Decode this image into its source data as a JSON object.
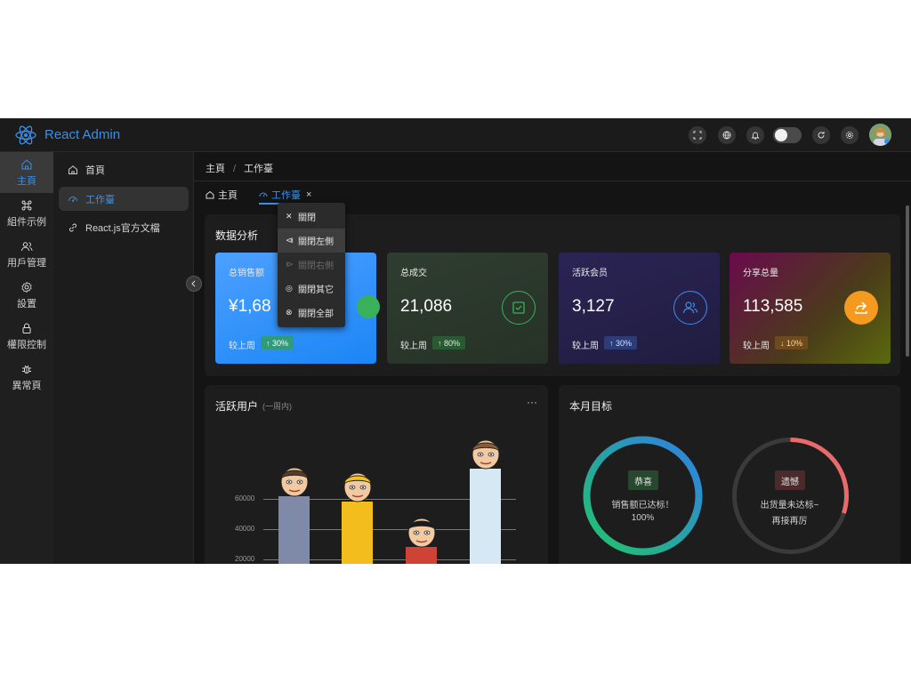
{
  "app": {
    "brand": "React Admin"
  },
  "header": {
    "icons": [
      "fullscreen-icon",
      "language-icon",
      "bell-icon",
      "theme-toggle",
      "refresh-icon",
      "settings-icon",
      "avatar"
    ]
  },
  "rail": {
    "items": [
      {
        "label": "主頁",
        "icon": "home-icon",
        "active": true
      },
      {
        "label": "組件示例",
        "icon": "command-icon"
      },
      {
        "label": "用戶管理",
        "icon": "users-icon"
      },
      {
        "label": "設置",
        "icon": "gear-icon"
      },
      {
        "label": "權限控制",
        "icon": "lock-icon"
      },
      {
        "label": "異常頁",
        "icon": "bug-icon"
      }
    ]
  },
  "submenu": {
    "items": [
      {
        "label": "首頁",
        "icon": "home-icon"
      },
      {
        "label": "工作臺",
        "icon": "dashboard-icon",
        "active": true
      },
      {
        "label": "React.js官方文檔",
        "icon": "link-icon"
      }
    ]
  },
  "breadcrumb": {
    "root": "主頁",
    "separator": "/",
    "current": "工作臺"
  },
  "tabs": [
    {
      "label": "主頁",
      "icon": "home-icon"
    },
    {
      "label": "工作臺",
      "icon": "dashboard-icon",
      "active": true,
      "close": "×"
    }
  ],
  "context_menu": {
    "items": [
      {
        "label": "關閉",
        "icon": "close-icon"
      },
      {
        "label": "關閉左側",
        "icon": "close-left-icon",
        "hover": true
      },
      {
        "label": "關閉右側",
        "icon": "close-right-icon",
        "disabled": true
      },
      {
        "label": "關閉其它",
        "icon": "close-others-icon"
      },
      {
        "label": "關閉全部",
        "icon": "close-all-icon"
      }
    ]
  },
  "analysis": {
    "title": "数据分析",
    "cards": [
      {
        "label": "总销售额",
        "value": "¥1,68",
        "compare": "较上周",
        "change": "30%",
        "direction": "up",
        "icon": "sales-icon"
      },
      {
        "label": "总成交",
        "value": "21,086",
        "compare": "较上周",
        "change": "80%",
        "direction": "up",
        "icon": "check-square-icon"
      },
      {
        "label": "活跃会员",
        "value": "3,127",
        "compare": "较上周",
        "change": "30%",
        "direction": "up",
        "icon": "users-icon"
      },
      {
        "label": "分享总量",
        "value": "113,585",
        "compare": "较上周",
        "change": "10%",
        "direction": "down",
        "icon": "share-icon"
      }
    ]
  },
  "active_users": {
    "title": "活跃用户",
    "subtitle": "(一周内)",
    "more": "···",
    "chart_data": {
      "type": "bar",
      "y_ticks": [
        20000,
        40000,
        60000
      ],
      "values": [
        62000,
        58000,
        28000,
        80000
      ],
      "colors": [
        "#7f8aa8",
        "#f2bd1d",
        "#cf4236",
        "#d7e8f5"
      ]
    }
  },
  "goals": {
    "title": "本月目标",
    "rings": [
      {
        "badge": "恭喜",
        "line1": "销售额已达标！",
        "line2": "100%",
        "progress": 1.0,
        "badge_bg": "#27472f",
        "badge_color": "#e6e6e6"
      },
      {
        "badge": "遗憾",
        "line1": "出货量未达标~",
        "line2": "再接再厉",
        "progress": 0.3,
        "badge_bg": "#4a2a2a",
        "badge_color": "#e6e6e6"
      }
    ]
  }
}
